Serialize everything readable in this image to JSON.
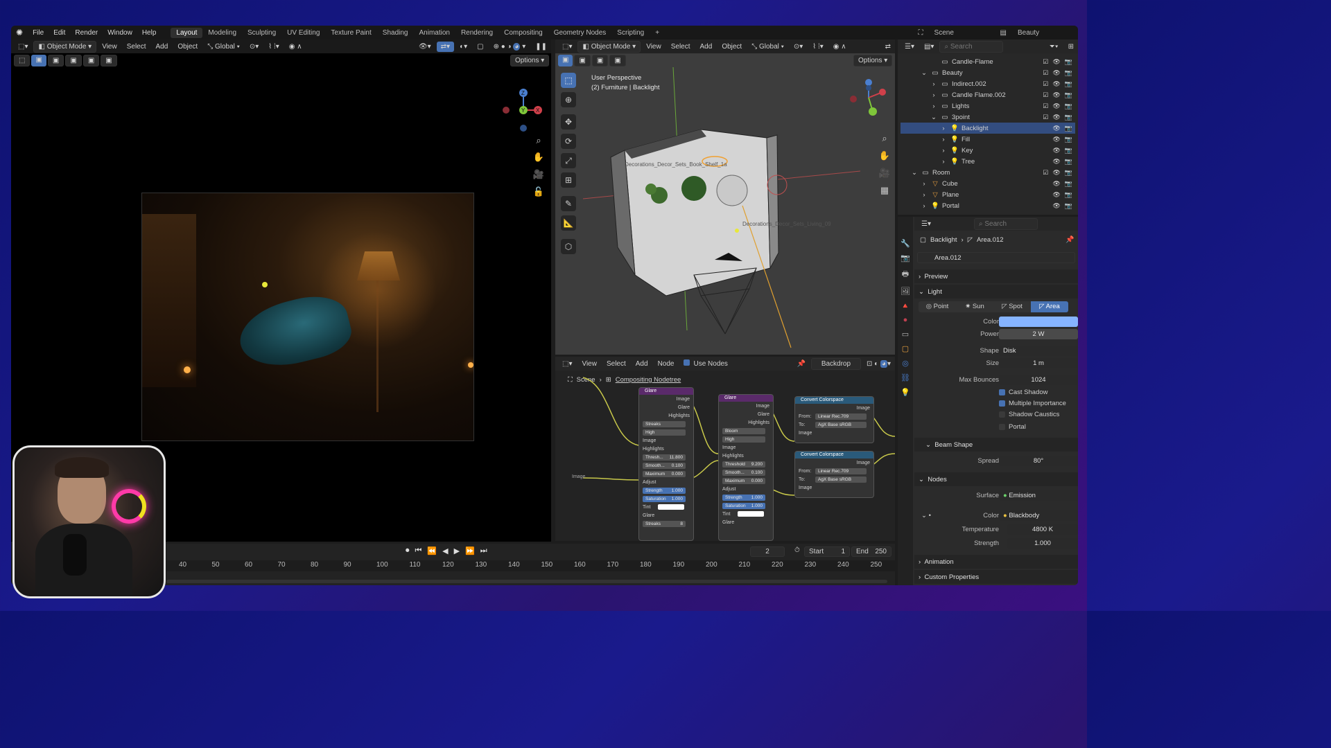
{
  "menu": {
    "items": [
      "File",
      "Edit",
      "Render",
      "Window",
      "Help"
    ]
  },
  "workspaces": [
    "Layout",
    "Modeling",
    "Sculpting",
    "UV Editing",
    "Texture Paint",
    "Shading",
    "Animation",
    "Rendering",
    "Compositing",
    "Geometry Nodes",
    "Scripting"
  ],
  "active_workspace": "Layout",
  "scene": {
    "label": "Scene",
    "view_layer": "Beauty"
  },
  "left_viewport": {
    "mode": "Object Mode",
    "menus": [
      "View",
      "Select",
      "Add",
      "Object"
    ],
    "orientation": "Global",
    "options": "Options"
  },
  "right_viewport": {
    "mode": "Object Mode",
    "menus": [
      "View",
      "Select",
      "Add",
      "Object"
    ],
    "orientation": "Global",
    "options": "Options",
    "perspective": "User Perspective",
    "context": "(2) Furniture | Backlight",
    "label_a": "Decorations_Decor_Sets_Book_Shelf_1a",
    "label_b": "Decorations_Decor_Sets_Living_09"
  },
  "outliner": {
    "search_placeholder": "Search",
    "rows": [
      {
        "name": "Candle-Flame",
        "indent": 3,
        "type": "collection",
        "expand": ""
      },
      {
        "name": "Beauty",
        "indent": 2,
        "type": "collection",
        "expand": "v"
      },
      {
        "name": "Indirect.002",
        "indent": 3,
        "type": "collection",
        "expand": ">"
      },
      {
        "name": "Candle Flame.002",
        "indent": 3,
        "type": "collection",
        "expand": ">"
      },
      {
        "name": "Lights",
        "indent": 3,
        "type": "collection",
        "expand": ">"
      },
      {
        "name": "3point",
        "indent": 3,
        "type": "collection",
        "expand": "v"
      },
      {
        "name": "Backlight",
        "indent": 4,
        "type": "light",
        "expand": ">",
        "selected": true
      },
      {
        "name": "Fill",
        "indent": 4,
        "type": "light",
        "expand": ">"
      },
      {
        "name": "Key",
        "indent": 4,
        "type": "light",
        "expand": ">"
      },
      {
        "name": "Tree",
        "indent": 4,
        "type": "light",
        "expand": ">"
      },
      {
        "name": "Room",
        "indent": 1,
        "type": "collection",
        "expand": "v"
      },
      {
        "name": "Cube",
        "indent": 2,
        "type": "mesh",
        "expand": ">"
      },
      {
        "name": "Plane",
        "indent": 2,
        "type": "mesh",
        "expand": ">"
      },
      {
        "name": "Portal",
        "indent": 2,
        "type": "light",
        "expand": ">"
      }
    ]
  },
  "properties": {
    "search_placeholder": "Search",
    "breadcrumb_object": "Backlight",
    "breadcrumb_data": "Area.012",
    "datablock": "Area.012",
    "sections": {
      "preview": "Preview",
      "light": "Light",
      "beam_shape": "Beam Shape",
      "nodes": "Nodes",
      "animation": "Animation",
      "custom": "Custom Properties"
    },
    "light_types": [
      "Point",
      "Sun",
      "Spot",
      "Area"
    ],
    "active_light_type": "Area",
    "color_label": "Color",
    "color_value": "#86b4ff",
    "power_label": "Power",
    "power": "2 W",
    "shape_label": "Shape",
    "shape": "Disk",
    "size_label": "Size",
    "size": "1 m",
    "bounces_label": "Max Bounces",
    "bounces": "1024",
    "cast_shadow": "Cast Shadow",
    "multiple_importance": "Multiple Importance",
    "shadow_caustics": "Shadow Caustics",
    "portal": "Portal",
    "spread_label": "Spread",
    "spread": "80°",
    "surface_label": "Surface",
    "surface": "Emission",
    "ncolor_label": "Color",
    "ncolor": "Blackbody",
    "temp_label": "Temperature",
    "temp": "4800 K",
    "strength_label": "Strength",
    "strength": "1.000"
  },
  "compositor": {
    "menus": [
      "View",
      "Select",
      "Add",
      "Node"
    ],
    "use_nodes": "Use Nodes",
    "backdrop": "Backdrop",
    "scene": "Scene",
    "tree": "Compositing Nodetree",
    "glare1": {
      "title": "Glare",
      "out": [
        "Image",
        "Glare",
        "Highlights"
      ],
      "type": "Streaks",
      "quality": "High",
      "image": "Image",
      "highlights": "Highlights",
      "threshold_l": "Thresh...",
      "threshold": "11.800",
      "smooth_l": "Smooth...",
      "smooth": "0.100",
      "max_l": "Maximum",
      "max": "0.000",
      "adjust": "Adjust",
      "strength_l": "Strength",
      "strength": "1.000",
      "sat_l": "Saturation",
      "sat": "1.000",
      "tint": "Tint",
      "glare": "Glare",
      "streaks_l": "Streaks",
      "streaks": "8"
    },
    "glare2": {
      "title": "Glare",
      "out": [
        "Image",
        "Glare",
        "Highlights"
      ],
      "type": "Bloom",
      "quality": "High",
      "image": "Image",
      "highlights": "Highlights",
      "threshold_l": "Threshold",
      "threshold": "9.200",
      "smooth_l": "Smooth...",
      "smooth": "0.100",
      "max_l": "Maximum",
      "max": "0.000",
      "adjust": "Adjust",
      "strength_l": "Strength",
      "strength": "1.000",
      "sat_l": "Saturation",
      "sat": "1.000",
      "tint": "Tint",
      "glare": "Glare"
    },
    "cc1": {
      "title": "Convert Colorspace",
      "out": "Image",
      "from_l": "From:",
      "from": "Linear Rec.709",
      "to_l": "To:",
      "to": "AgX Base sRGB",
      "in": "Image"
    },
    "cc2": {
      "title": "Convert Colorspace",
      "out": "Image",
      "from_l": "From:",
      "from": "Linear Rec.709",
      "to_l": "To:",
      "to": "AgX Base sRGB",
      "in": "Image"
    },
    "left_image": "Image",
    "left_image2": "Image"
  },
  "timeline": {
    "ticks": [
      "40",
      "50",
      "60",
      "70",
      "80",
      "90",
      "100",
      "110",
      "120",
      "130",
      "140",
      "150",
      "160",
      "170",
      "180",
      "190",
      "200",
      "210",
      "220",
      "230",
      "240",
      "250"
    ],
    "current": "2",
    "start_l": "Start",
    "start": "1",
    "end_l": "End",
    "end": "250"
  }
}
